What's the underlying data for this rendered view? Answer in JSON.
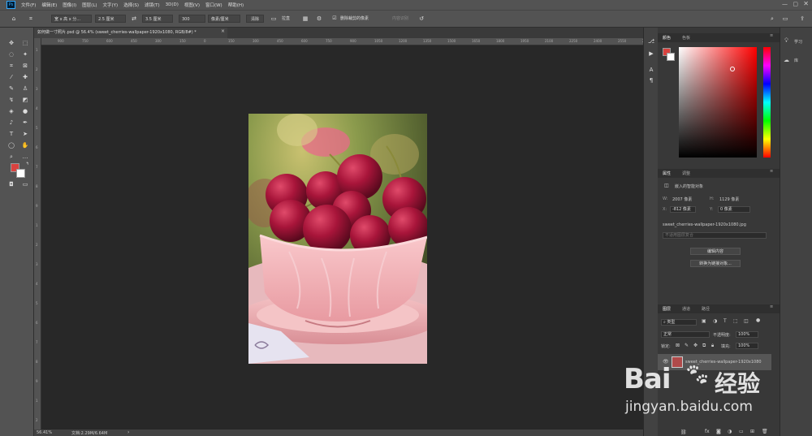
{
  "menubar": {
    "items": [
      "文件(F)",
      "编辑(E)",
      "图像(I)",
      "图层(L)",
      "文字(Y)",
      "选择(S)",
      "滤镜(T)",
      "3D(D)",
      "视图(V)",
      "窗口(W)",
      "帮助(H)"
    ]
  },
  "options": {
    "ratio": "宽 x 高 x 分...",
    "width": "2.5 厘米",
    "height": "3.5 厘米",
    "resolution": "300",
    "res_unit": "像素/厘米",
    "clear": "清除",
    "straighten": "拉直",
    "delete_cropped": "删除裁剪的像素",
    "content_aware": "内容识别"
  },
  "document": {
    "tab_title": "如何做一寸照片.psd @ 56.4% (sweet_cherries-wallpaper-1920x1080, RGB/8#) *",
    "zoom": "56.41%",
    "doc_size": "文档:2.29M/6.64M"
  },
  "rulers": {
    "h_ticks": [
      "900",
      "750",
      "600",
      "450",
      "300",
      "150",
      "0",
      "150",
      "300",
      "450",
      "600",
      "750",
      "900",
      "1050",
      "1200",
      "1350",
      "1500",
      "1650",
      "1800",
      "1950",
      "2100",
      "2250",
      "2400",
      "2550",
      "2700"
    ],
    "v_ticks": [
      "1",
      "2",
      "3",
      "4",
      "5",
      "6",
      "7",
      "8",
      "9",
      "1",
      "2",
      "3",
      "4",
      "5",
      "6",
      "7",
      "8",
      "9",
      "1",
      "2"
    ]
  },
  "color_panel": {
    "tabs": [
      "颜色",
      "色板"
    ],
    "fg_color": "#d9423f",
    "bg_color": "#ffffff",
    "hue_color": "#ff0000"
  },
  "properties": {
    "tabs": [
      "属性",
      "调整"
    ],
    "type": "嵌入的智能对象",
    "w_label": "W:",
    "w_value": "2007 像素",
    "h_label": "H:",
    "h_value": "1129 像素",
    "x_label": "X:",
    "x_value": "-812 像素",
    "y_label": "Y:",
    "y_value": "0 像素",
    "filename": "sweet_cherries-wallpaper-1920x1080.jpg",
    "comp_placeholder": "不适用图层复合",
    "edit_btn": "编辑内容",
    "convert_btn": "转换为链接对象..."
  },
  "layers": {
    "tabs": [
      "图层",
      "通道",
      "路径"
    ],
    "filter": "类型",
    "blend": "正常",
    "opacity_label": "不透明度:",
    "opacity": "100%",
    "lock_label": "锁定:",
    "fill_label": "填充:",
    "fill": "100%",
    "items": [
      {
        "name": "sweet_cherries-wallpaper-1920x1080"
      }
    ]
  },
  "learn": {
    "learn": "学习",
    "library": "库"
  },
  "watermark": {
    "brand": "Bai",
    "brand2": "经验",
    "url": "jingyan.baidu.com"
  }
}
